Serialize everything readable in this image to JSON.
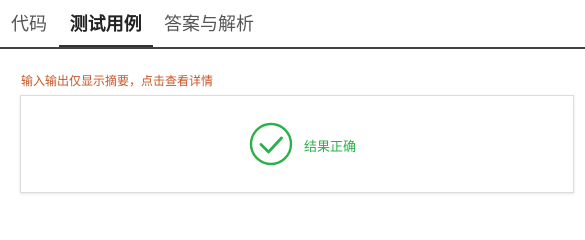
{
  "tabs": [
    {
      "label": "代码",
      "active": false
    },
    {
      "label": "测试用例",
      "active": true
    },
    {
      "label": "答案与解析",
      "active": false
    }
  ],
  "notice": "输入输出仅显示摘要，点击查看详情",
  "result": {
    "icon": "check-circle-icon",
    "text": "结果正确",
    "color": "#2bb04a"
  },
  "colors": {
    "notice": "#c8572a",
    "active_tab": "#222222",
    "inactive_tab": "#555555"
  }
}
